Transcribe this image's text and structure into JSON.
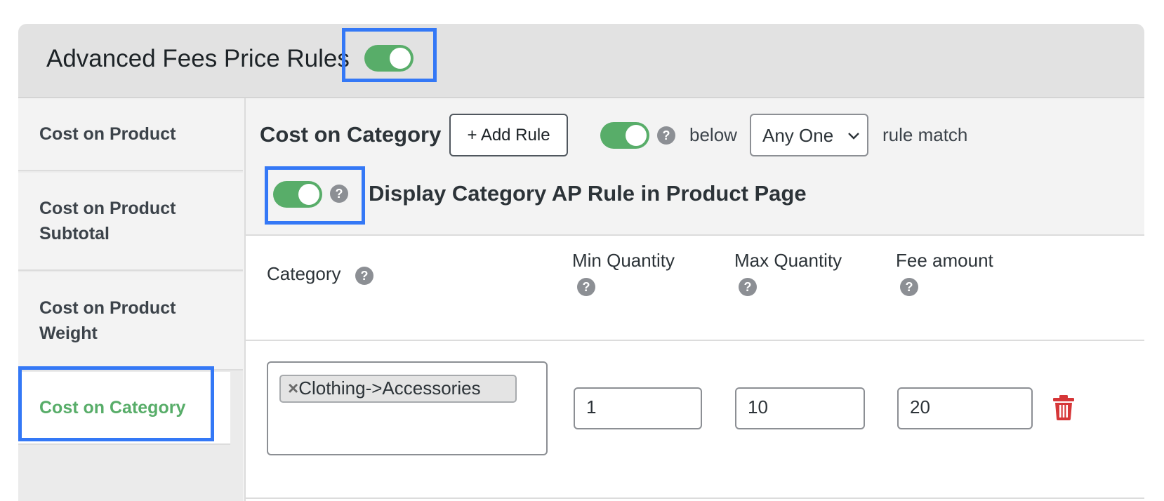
{
  "header": {
    "title": "Advanced Fees Price Rules",
    "toggle_on": true
  },
  "sidebar": {
    "items": [
      {
        "label": "Cost on Product"
      },
      {
        "label": "Cost on Product Subtotal"
      },
      {
        "label": "Cost on Product Weight"
      },
      {
        "label": "Cost on Category",
        "active": true
      }
    ]
  },
  "section": {
    "title": "Cost on Category",
    "add_rule_label": "+ Add Rule",
    "rule_toggle_on": true,
    "below_label": "below",
    "match_select_value": "Any One",
    "rule_match_label": "rule match",
    "display_toggle_on": true,
    "display_label": "Display Category AP Rule in Product Page"
  },
  "table": {
    "headers": {
      "category": "Category",
      "min_quantity": "Min Quantity",
      "max_quantity": "Max Quantity",
      "fee_amount": "Fee amount"
    },
    "rows": [
      {
        "category_tag": "Clothing->Accessories",
        "min": "1",
        "max": "10",
        "fee": "20"
      }
    ]
  },
  "help_glyph": "?",
  "chip_remove_glyph": "×",
  "colors": {
    "accent_green": "#58ad69",
    "highlight_blue": "#3478f6",
    "delete_red": "#d63638"
  },
  "icons": [
    "help-icon",
    "trash-icon",
    "chevron-down-icon",
    "remove-tag-icon"
  ]
}
